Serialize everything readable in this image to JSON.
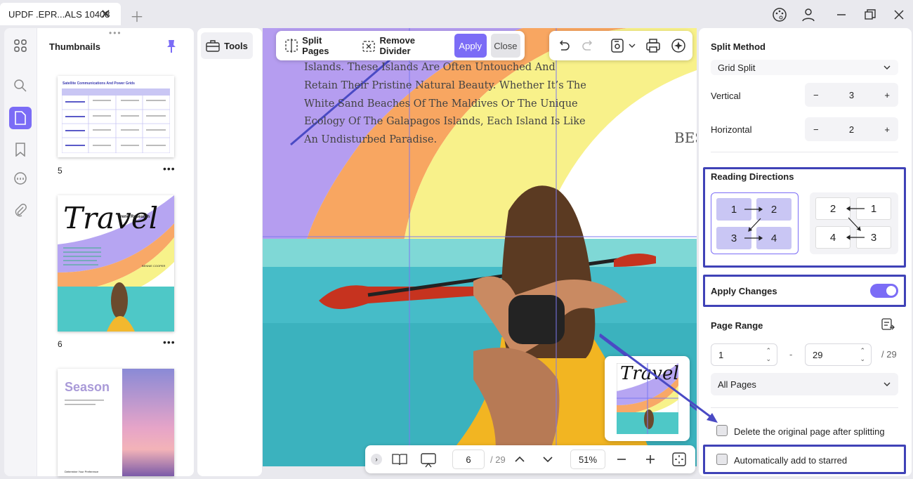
{
  "tab": {
    "title": "UPDF .EPR...ALS 10408"
  },
  "thumbnails": {
    "title": "Thumbnails",
    "pages": [
      {
        "num": "5"
      },
      {
        "num": "6"
      }
    ],
    "t5_title": "Satellite Communications And Power Grids",
    "t6_title": "Travel",
    "t6_sub": "Trend Research",
    "t6_author": "BENNIE COOPER",
    "t7_title": "Season",
    "t7_foot": "Determine Your Preference"
  },
  "tools": {
    "label": "Tools"
  },
  "splitbar": {
    "split_pages": "Split Pages",
    "remove_divider": "Remove Divider",
    "apply": "Apply",
    "close": "Close"
  },
  "page_text": {
    "lines": [
      "Islands. These Islands Are Often Untouched And",
      "Retain Their Pristine Natural Beauty. Whether It’s The",
      "White Sand Beaches Of The Maldives Or The Unique",
      "Ecology Of The Galapagos Islands, Each Island Is Like",
      "An Undisturbed Paradise."
    ],
    "corner": "BES"
  },
  "preview": {
    "title": "Travel"
  },
  "bottombar": {
    "page": "6",
    "total": "/ 29",
    "zoom": "51%"
  },
  "right": {
    "split_method": "Split Method",
    "split_type": "Grid Split",
    "vertical": "Vertical",
    "vertical_val": "3",
    "horizontal": "Horizontal",
    "horizontal_val": "2",
    "reading": "Reading Directions",
    "rd1": [
      "1",
      "2",
      "3",
      "4"
    ],
    "rd2": [
      "2",
      "1",
      "4",
      "3"
    ],
    "apply_changes": "Apply Changes",
    "apply_changes_on": true,
    "page_range": "Page Range",
    "from": "1",
    "dash": "-",
    "to": "29",
    "of": "/ 29",
    "pages_select": "All Pages",
    "delete_original": "Delete the original page after splitting",
    "auto_star": "Automatically add to starred"
  },
  "colors": {
    "accent": "#7b6cf6",
    "highlight": "#3f42b7",
    "arrow": "#4a4ac4"
  }
}
